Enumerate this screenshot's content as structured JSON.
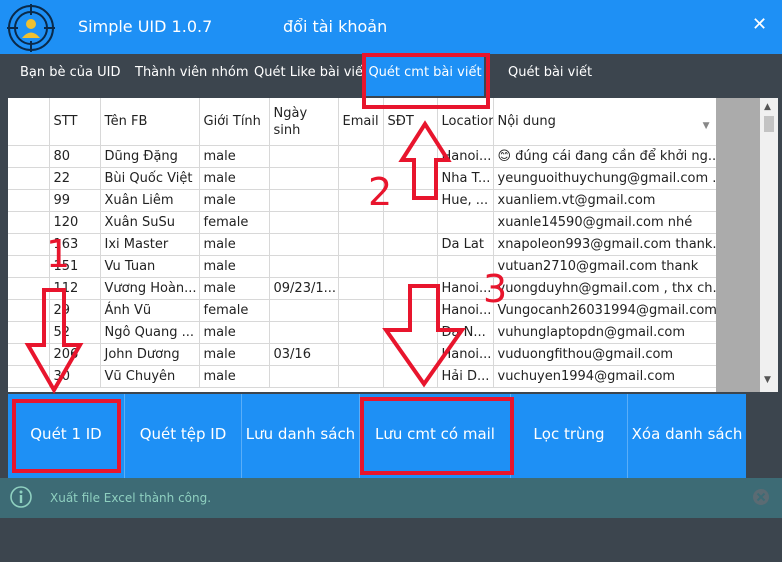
{
  "app": {
    "title": "Simple UID 1.0.7",
    "switch_label": "đổi tài khoản",
    "close_glyph": "✕"
  },
  "tabs": [
    {
      "label": "Bạn bè của UID"
    },
    {
      "label": "Thành viên nhóm"
    },
    {
      "label": "Quét Like bài viết"
    },
    {
      "label": "Quét cmt bài viết"
    },
    {
      "label": "Quét bài viết"
    }
  ],
  "table": {
    "headers": [
      "STT",
      "Tên FB",
      "Giới Tính",
      "Ngày sinh",
      "Email",
      "SĐT",
      "Location",
      "Nội dung"
    ],
    "rows": [
      [
        "80",
        "Dũng Đặng",
        "male",
        "",
        "",
        "",
        "Hanoi...",
        "😊 đúng cái đang cần để khởi ng..."
      ],
      [
        "22",
        "Bùi Quốc Việt",
        "male",
        "",
        "",
        "",
        "Nha T...",
        "yeunguoithuychung@gmail.com ..."
      ],
      [
        "99",
        "Xuân Liêm",
        "male",
        "",
        "",
        "",
        "Hue, ...",
        "xuanliem.vt@gmail.com"
      ],
      [
        "120",
        "Xuân SuSu",
        "female",
        "",
        "",
        "",
        "",
        "xuanle14590@gmail.com nhé"
      ],
      [
        "163",
        "Ixi Master",
        "male",
        "",
        "",
        "",
        "Da Lat",
        "xnapoleon993@gmail.com thank..."
      ],
      [
        "151",
        "Vu Tuan",
        "male",
        "",
        "",
        "",
        "",
        "vutuan2710@gmail.com   thank"
      ],
      [
        "112",
        "Vương Hoàn...",
        "male",
        "09/23/1...",
        "",
        "",
        "Hanoi...",
        "vuongduyhn@gmail.com , thx ch..."
      ],
      [
        "29",
        "Ánh Vũ",
        "female",
        "",
        "",
        "",
        "Hanoi...",
        "Vungocanh26031994@gmail.com"
      ],
      [
        "52",
        "Ngô Quang ...",
        "male",
        "",
        "",
        "",
        "Da N...",
        "vuhunglaptopdn@gmail.com"
      ],
      [
        "206",
        "John Dương",
        "male",
        "03/16",
        "",
        "",
        "Hanoi...",
        "vuduongfithou@gmail.com"
      ],
      [
        "30",
        "Vũ Chuyên",
        "male",
        "",
        "",
        "",
        "Hải D...",
        "vuchuyen1994@gmail.com"
      ]
    ]
  },
  "buttons": [
    {
      "label": "Quét 1 ID"
    },
    {
      "label": "Quét tệp ID"
    },
    {
      "label": "Lưu danh sách"
    },
    {
      "label": "Lưu cmt có mail"
    },
    {
      "label": "Lọc trùng"
    },
    {
      "label": "Xóa danh sách"
    }
  ],
  "status": {
    "message": "Xuất file Excel thành công."
  },
  "annotations": {
    "n1": "1",
    "n2": "2",
    "n3": "3"
  },
  "colors": {
    "accent": "#1e90f5",
    "background": "#3c454e",
    "status": "#3d6b75",
    "highlight": "#e8152d"
  }
}
